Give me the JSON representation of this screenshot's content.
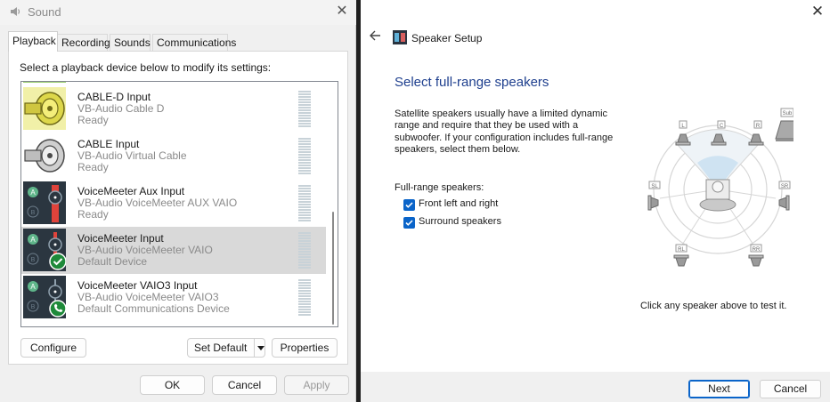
{
  "sound": {
    "title": "Sound",
    "tabs": [
      "Playback",
      "Recording",
      "Sounds",
      "Communications"
    ],
    "active_tab": "Playback",
    "instruction": "Select a playback device below to modify its settings:",
    "devices": [
      {
        "name": "CABLE-D Input",
        "sub": "VB-Audio Cable D",
        "status": "Ready",
        "selected": false,
        "thumb": "cable-yellow"
      },
      {
        "name": "CABLE Input",
        "sub": "VB-Audio Virtual Cable",
        "status": "Ready",
        "selected": false,
        "thumb": "cable-gray"
      },
      {
        "name": "VoiceMeeter Aux Input",
        "sub": "VB-Audio VoiceMeeter AUX VAIO",
        "status": "Ready",
        "selected": false,
        "thumb": "voicemeeter-red"
      },
      {
        "name": "VoiceMeeter Input",
        "sub": "VB-Audio VoiceMeeter VAIO",
        "status": "Default Device",
        "selected": true,
        "thumb": "voicemeeter-check"
      },
      {
        "name": "VoiceMeeter VAIO3 Input",
        "sub": "VB-Audio VoiceMeeter VAIO3",
        "status": "Default Communications Device",
        "selected": false,
        "thumb": "voicemeeter-phone"
      }
    ],
    "buttons": {
      "configure": "Configure",
      "set_default": "Set Default",
      "properties": "Properties"
    },
    "footer": {
      "ok": "OK",
      "cancel": "Cancel",
      "apply": "Apply"
    }
  },
  "setup": {
    "window_title": "Speaker Setup",
    "heading": "Select full-range speakers",
    "description": "Satellite speakers usually have a limited dynamic range and require that they be used with a subwoofer.  If your configuration includes full-range speakers, select them below.",
    "full_range_label": "Full-range speakers:",
    "options": [
      {
        "label": "Front left and right",
        "checked": true
      },
      {
        "label": "Surround speakers",
        "checked": true
      }
    ],
    "speaker_labels": {
      "l": "L",
      "c": "C",
      "r": "R",
      "sub": "Sub",
      "sl": "SL",
      "sr": "SR",
      "rl": "RL",
      "rr": "RR"
    },
    "hint": "Click any speaker above to test it.",
    "buttons": {
      "next": "Next",
      "cancel": "Cancel"
    }
  }
}
